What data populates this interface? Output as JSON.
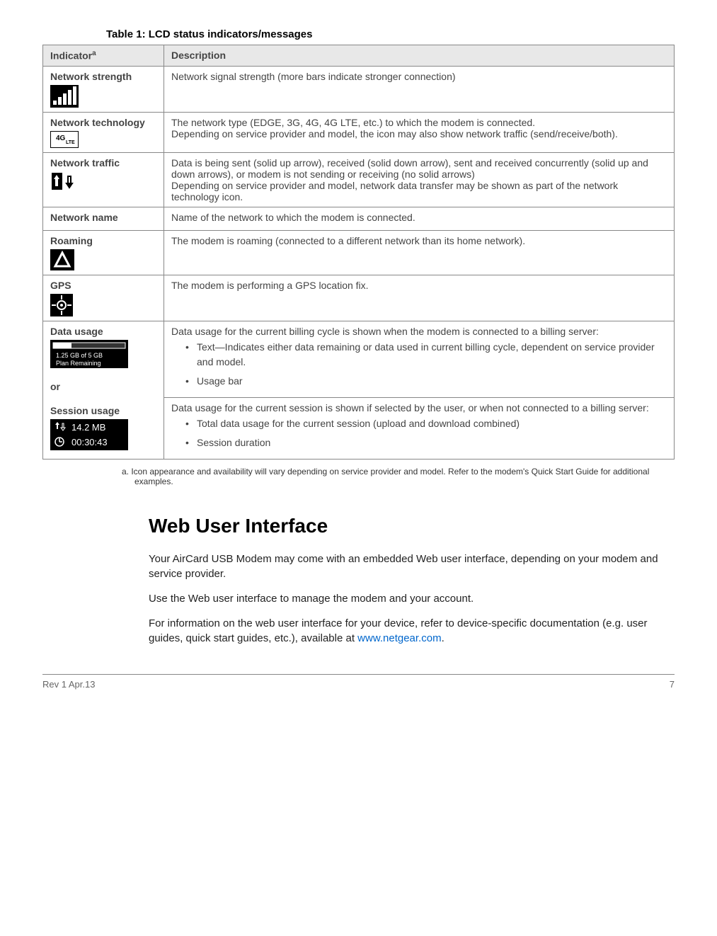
{
  "table": {
    "caption": "Table 1: LCD status indicators/messages",
    "headers": {
      "indicator": "Indicator",
      "indicator_sup": "a",
      "description": "Description"
    },
    "rows": [
      {
        "label": "Network strength",
        "desc": "Network signal strength (more bars indicate stronger connection)"
      },
      {
        "label": "Network technology",
        "desc": "The network type (EDGE, 3G, 4G, 4G LTE, etc.) to which the modem is connected.\nDepending on service provider and model, the icon may also show network traffic (send/receive/both)."
      },
      {
        "label": "Network traffic",
        "desc": "Data is being sent (solid up arrow), received (solid down arrow), sent and received concurrently (solid up and down arrows), or modem is not sending or receiving (no solid arrows)\nDepending on service provider and model, network data transfer may be shown as part of the network technology icon."
      },
      {
        "label": "Network name",
        "desc": "Name of the network to which the modem is connected."
      },
      {
        "label": "Roaming",
        "desc": "The modem is roaming (connected to a different network than its home network)."
      },
      {
        "label": "GPS",
        "desc": "The modem is performing a GPS location fix."
      }
    ],
    "data_usage": {
      "label1": "Data usage",
      "or": "or",
      "label2": "Session usage",
      "plan_text1": "1.25 GB of 5 GB",
      "plan_text2": "Plan Remaining",
      "session_mb": "14.2 MB",
      "session_time": "00:30:43",
      "desc1_intro": "Data usage for the current billing cycle is shown when the modem is connected to a billing server:",
      "desc1_bullets": [
        "Text—Indicates either data remaining or data used in current billing cycle, dependent on service provider and model.",
        "Usage bar"
      ],
      "desc2_intro": "Data usage for the current session is shown if selected by the user, or when not connected to a billing server:",
      "desc2_bullets": [
        "Total data usage for the current session (upload and download combined)",
        "Session duration"
      ]
    }
  },
  "footnote": "a.   Icon appearance and availability will vary depending on service provider and model. Refer to the modem's Quick Start Guide for additional examples.",
  "section": {
    "heading": "Web User Interface",
    "p1": "Your AirCard USB Modem may come with an embedded Web user interface, depending on your modem and service provider.",
    "p2": "Use the Web user interface to manage the modem and your account.",
    "p3a": "For information on the web user interface for your device, refer to device-specific documentation (e.g. user guides, quick start guides, etc.), available at ",
    "p3link": "www.netgear.com",
    "p3b": "."
  },
  "footer": {
    "left": "Rev 1  Apr.13",
    "right": "7"
  }
}
